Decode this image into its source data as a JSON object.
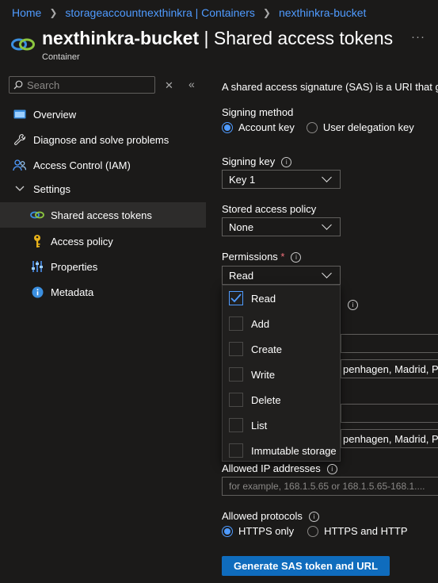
{
  "breadcrumb": {
    "items": [
      "Home",
      "storageaccountnexthinkra | Containers",
      "nexthinkra-bucket"
    ]
  },
  "header": {
    "resource_name": "nexthinkra-bucket",
    "separator": "|",
    "section": "Shared access tokens",
    "subtitle": "Container",
    "more": "···"
  },
  "sidebar": {
    "search_placeholder": "Search",
    "items": [
      {
        "label": "Overview",
        "icon": "overview-icon"
      },
      {
        "label": "Diagnose and solve problems",
        "icon": "wrench-icon"
      },
      {
        "label": "Access Control (IAM)",
        "icon": "people-icon"
      },
      {
        "label": "Settings",
        "icon": "chevron-down-icon"
      },
      {
        "label": "Shared access tokens",
        "icon": "link-icon",
        "active": true
      },
      {
        "label": "Access policy",
        "icon": "key-icon"
      },
      {
        "label": "Properties",
        "icon": "sliders-icon"
      },
      {
        "label": "Metadata",
        "icon": "info-icon"
      }
    ]
  },
  "main": {
    "intro": "A shared access signature (SAS) is a URI that gra",
    "signing_method": {
      "label": "Signing method",
      "options": [
        "Account key",
        "User delegation key"
      ],
      "selected": "Account key"
    },
    "signing_key": {
      "label": "Signing key",
      "value": "Key 1"
    },
    "stored_access_policy": {
      "label": "Stored access policy",
      "value": "None"
    },
    "permissions": {
      "label": "Permissions",
      "required_mark": "*",
      "value": "Read",
      "options": [
        {
          "label": "Read",
          "checked": true
        },
        {
          "label": "Add",
          "checked": false
        },
        {
          "label": "Create",
          "checked": false
        },
        {
          "label": "Write",
          "checked": false
        },
        {
          "label": "Delete",
          "checked": false
        },
        {
          "label": "List",
          "checked": false
        },
        {
          "label": "Immutable storage",
          "checked": false
        }
      ]
    },
    "start_timezone": "penhagen, Madrid, Pa",
    "expiry_timezone": "penhagen, Madrid, Pa",
    "allowed_ip": {
      "label": "Allowed IP addresses",
      "placeholder": "for example, 168.1.5.65 or 168.1.5.65-168.1...."
    },
    "allowed_protocols": {
      "label": "Allowed protocols",
      "options": [
        "HTTPS only",
        "HTTPS and HTTP"
      ],
      "selected": "HTTPS only"
    },
    "generate_button": "Generate SAS token and URL"
  },
  "colors": {
    "background": "#1b1a19",
    "link": "#4f9bff",
    "primary_button": "#0f6cbd",
    "active_nav": "#2d2c2b",
    "required": "#f1707b"
  }
}
